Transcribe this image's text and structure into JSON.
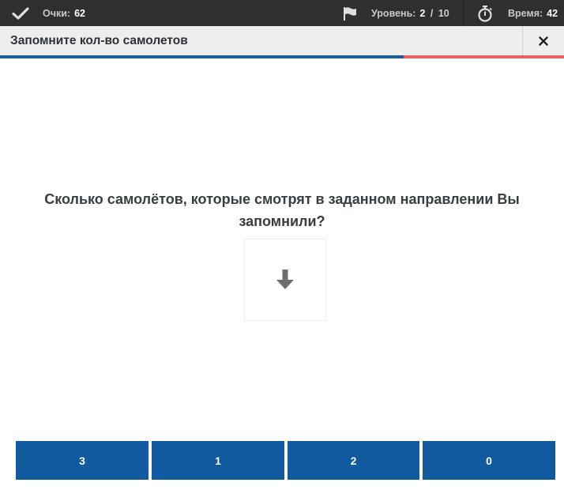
{
  "status_bar": {
    "score_label": "Очки:",
    "score_value": "62",
    "level_label": "Уровень:",
    "level_current": "2",
    "level_separator": "/",
    "level_total": "10",
    "time_label": "Время:",
    "time_value": "42",
    "icons": [
      "checkmark-icon",
      "flag-icon",
      "stopwatch-icon"
    ]
  },
  "window": {
    "title": "Запомните кол-во самолетов",
    "close_icon": "close-icon"
  },
  "progress": {
    "fraction": 0.715
  },
  "question": {
    "text": "Сколько самолётов, которые смотрят в заданном направлении Вы запомнили?",
    "direction_icon": "arrow-down-icon"
  },
  "answers": [
    "3",
    "1",
    "2",
    "0"
  ],
  "colors": {
    "topbar_bg": "#2e2f30",
    "title_bg": "#eeeeee",
    "progress_fill": "#1a5f9a",
    "progress_remaining": "#e8635e",
    "answer_bg": "#125aa0",
    "question_text": "#383d42"
  }
}
